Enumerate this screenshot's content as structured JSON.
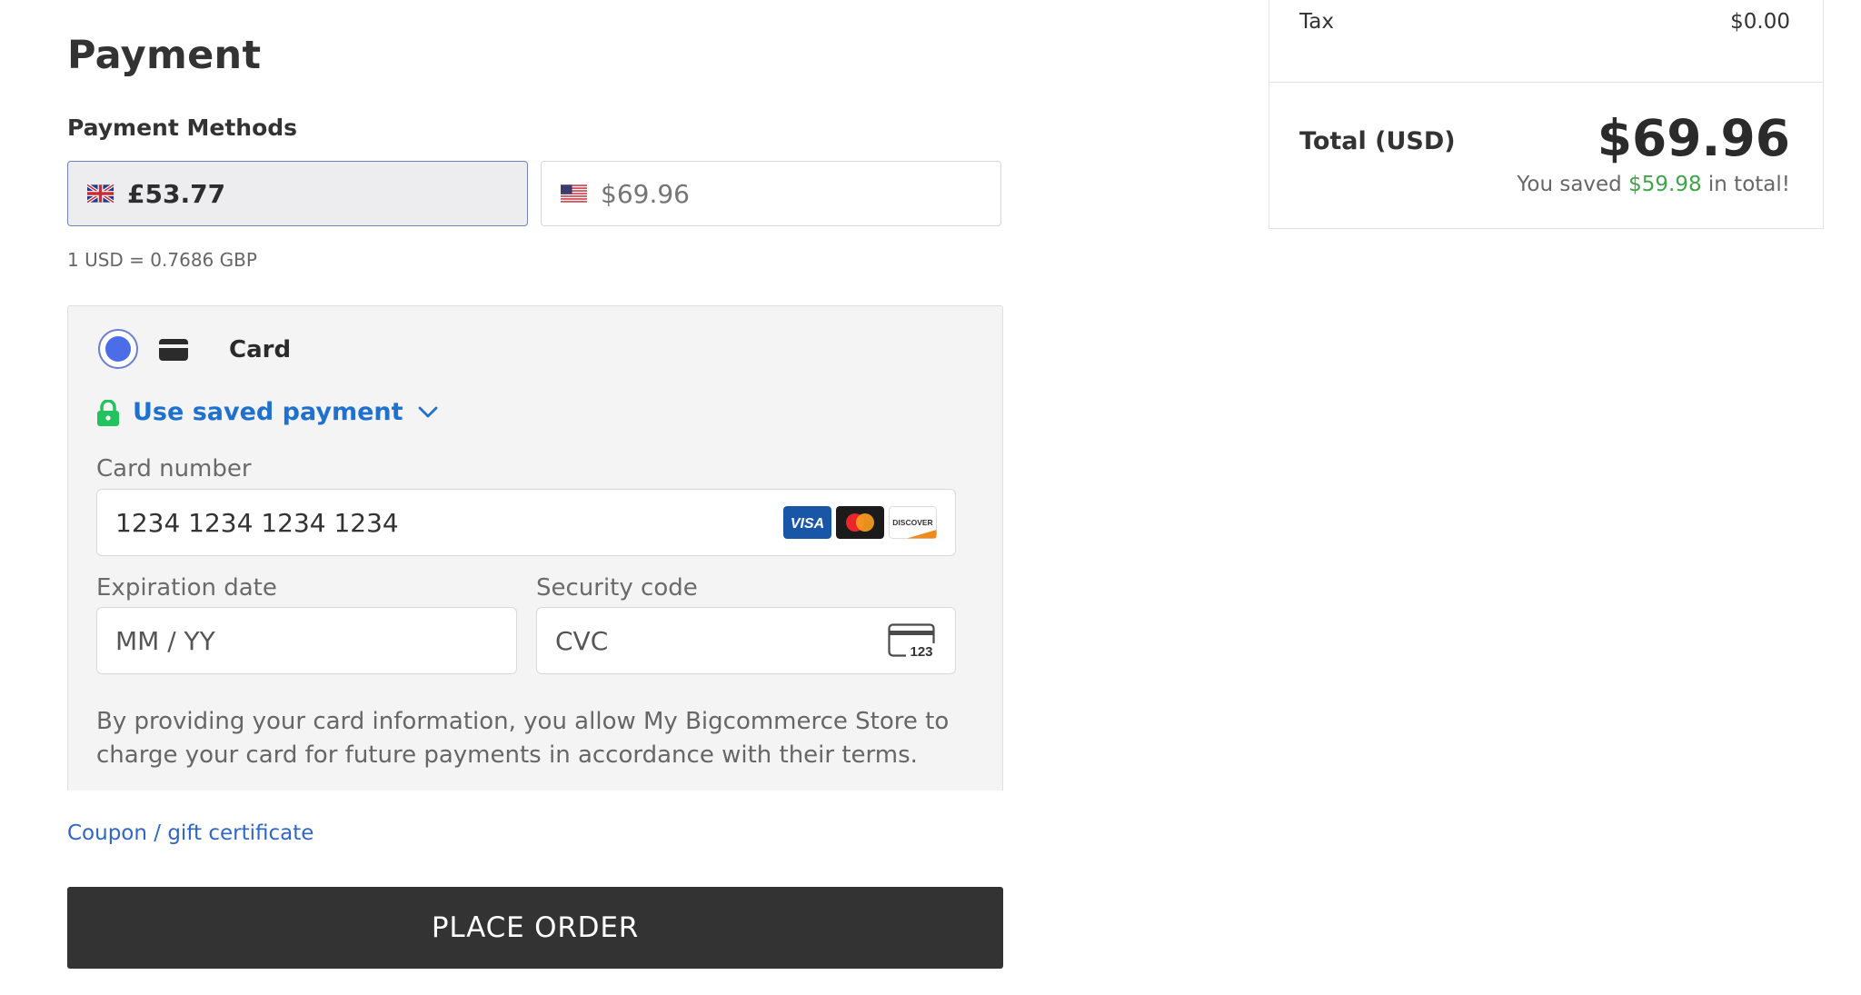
{
  "payment": {
    "title": "Payment",
    "methods_label": "Payment Methods",
    "currencies": [
      {
        "code": "GBP",
        "amount": "£53.77",
        "flag": "uk-flag-icon",
        "selected": true
      },
      {
        "code": "USD",
        "amount": "$69.96",
        "flag": "us-flag-icon",
        "selected": false
      }
    ],
    "exchange_rate": "1 USD = 0.7686 GBP"
  },
  "card": {
    "label": "Card",
    "icon": "credit-card-icon",
    "saved_payment": "Use saved payment",
    "card_number_label": "Card number",
    "card_number_placeholder": "1234 1234 1234 1234",
    "brands": [
      "VISA",
      "Mastercard",
      "DISCOVER"
    ],
    "expiration_label": "Expiration date",
    "expiration_placeholder": "MM / YY",
    "security_label": "Security code",
    "security_placeholder": "CVC",
    "cvc_icon_text": "123",
    "terms": "By providing your card information, you allow My Bigcommerce Store to charge your card for future payments in accordance with their terms."
  },
  "coupon_link": "Coupon / gift certificate",
  "place_order": "PLACE ORDER",
  "summary": {
    "tax_label": "Tax",
    "tax_value": "$0.00",
    "total_label": "Total (USD)",
    "total_value": "$69.96",
    "savings_prefix": "You saved",
    "savings_amount": "$59.98",
    "savings_suffix": "in total!"
  },
  "colors": {
    "accent_blue": "#1f71d0",
    "radio_blue": "#4b6ee8",
    "savings_green": "#3fa44a",
    "lock_green": "#22c35e",
    "button_dark": "#333333"
  }
}
